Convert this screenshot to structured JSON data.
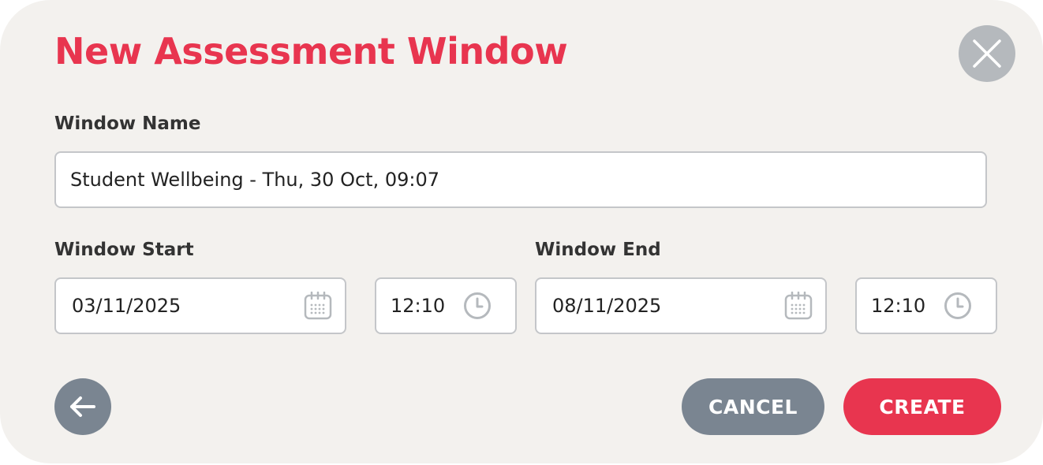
{
  "modal": {
    "title": "New Assessment Window",
    "close_icon": "close-icon",
    "window_name": {
      "label": "Window Name",
      "value": "Student Wellbeing - Thu, 30 Oct, 09:07"
    },
    "window_start": {
      "label": "Window Start",
      "date": "03/11/2025",
      "time": "12:10",
      "date_icon": "calendar-icon",
      "time_icon": "clock-icon"
    },
    "window_end": {
      "label": "Window End",
      "date": "08/11/2025",
      "time": "12:10",
      "date_icon": "calendar-icon",
      "time_icon": "clock-icon"
    },
    "buttons": {
      "back_icon": "arrow-left-icon",
      "cancel": "CANCEL",
      "create": "CREATE"
    }
  },
  "colors": {
    "accent": "#e8354f",
    "secondary_button": "#7a8591",
    "close_button": "#b5b9bd",
    "modal_bg": "#f3f1ee",
    "field_border": "#c4c6c9"
  }
}
